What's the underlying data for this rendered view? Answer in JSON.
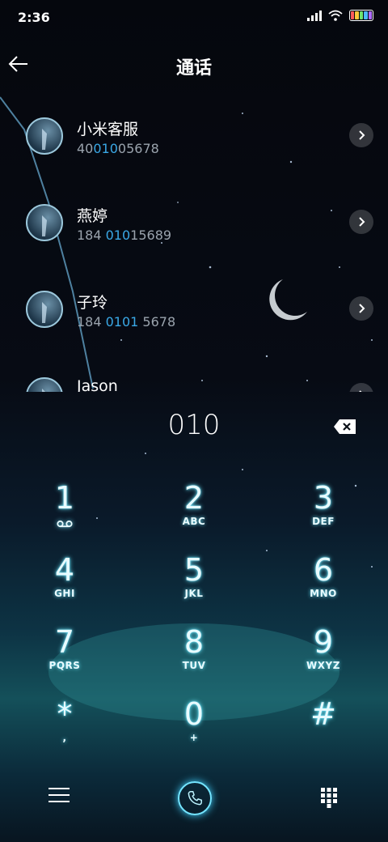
{
  "status": {
    "time": "2:36"
  },
  "header": {
    "title": "通话"
  },
  "contacts": [
    {
      "name": "小米客服",
      "num_pre": "40",
      "num_hl": "010",
      "num_post": "05678"
    },
    {
      "name": "燕婷",
      "num_pre": "184 ",
      "num_hl": "010",
      "num_post": "15689"
    },
    {
      "name": "子玲",
      "num_pre": "184 ",
      "num_hl": "0101",
      "num_post": " 5678"
    },
    {
      "name": "Jason",
      "num_pre": "",
      "num_hl": "",
      "num_post": ""
    }
  ],
  "dialer": {
    "input": "010",
    "keys": [
      {
        "digit": "1",
        "letters": ""
      },
      {
        "digit": "2",
        "letters": "ABC"
      },
      {
        "digit": "3",
        "letters": "DEF"
      },
      {
        "digit": "4",
        "letters": "GHI"
      },
      {
        "digit": "5",
        "letters": "JKL"
      },
      {
        "digit": "6",
        "letters": "MNO"
      },
      {
        "digit": "7",
        "letters": "PQRS"
      },
      {
        "digit": "8",
        "letters": "TUV"
      },
      {
        "digit": "9",
        "letters": "WXYZ"
      },
      {
        "digit": "*",
        "letters": ","
      },
      {
        "digit": "0",
        "letters": "+"
      },
      {
        "digit": "#",
        "letters": ""
      }
    ]
  },
  "colors": {
    "highlight": "#3aa8e6",
    "glow": "#6fe9ff"
  },
  "icons": [
    "back-arrow-icon",
    "chevron-right-icon",
    "delete-icon",
    "voicemail-icon",
    "menu-icon",
    "phone-icon",
    "dialpad-icon"
  ]
}
